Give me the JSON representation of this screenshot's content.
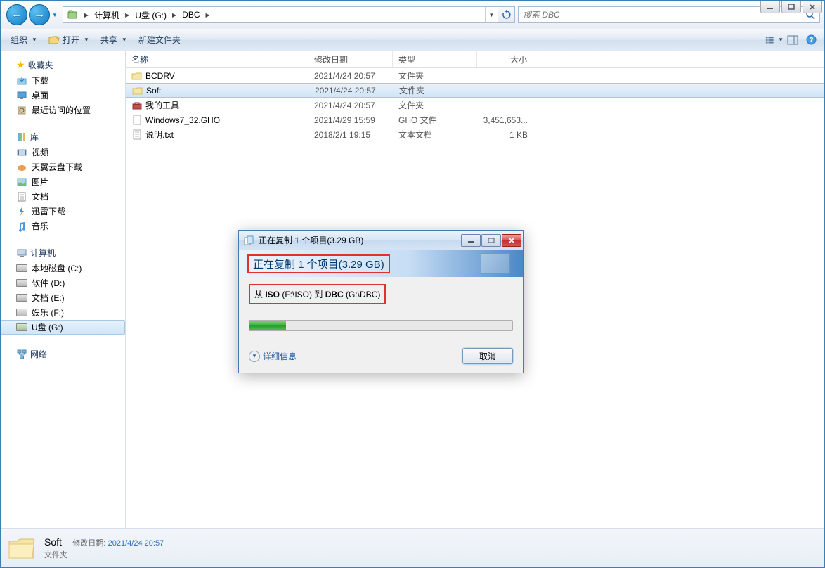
{
  "window_controls": {
    "minimize": "min",
    "maximize": "max",
    "close": "close"
  },
  "breadcrumbs": [
    {
      "label": "计算机"
    },
    {
      "label": "U盘 (G:)"
    },
    {
      "label": "DBC"
    }
  ],
  "search": {
    "placeholder": "搜索 DBC"
  },
  "toolbar": {
    "organize": "组织",
    "open": "打开",
    "share": "共享",
    "newfolder": "新建文件夹"
  },
  "tree": {
    "favorites": {
      "label": "收藏夹",
      "items": [
        "下载",
        "桌面",
        "最近访问的位置"
      ]
    },
    "libraries": {
      "label": "库",
      "items": [
        "视频",
        "天翼云盘下载",
        "图片",
        "文档",
        "迅雷下载",
        "音乐"
      ]
    },
    "computer": {
      "label": "计算机",
      "items": [
        "本地磁盘 (C:)",
        "软件 (D:)",
        "文档 (E:)",
        "娱乐 (F:)",
        "U盘 (G:)"
      ]
    },
    "network": {
      "label": "网络"
    }
  },
  "columns": {
    "name": "名称",
    "date": "修改日期",
    "type": "类型",
    "size": "大小"
  },
  "files": [
    {
      "name": "BCDRV",
      "date": "2021/4/24 20:57",
      "type": "文件夹",
      "size": "",
      "icon": "folder"
    },
    {
      "name": "Soft",
      "date": "2021/4/24 20:57",
      "type": "文件夹",
      "size": "",
      "icon": "folder",
      "selected": true
    },
    {
      "name": "我的工具",
      "date": "2021/4/24 20:57",
      "type": "文件夹",
      "size": "",
      "icon": "toolbox"
    },
    {
      "name": "Windows7_32.GHO",
      "date": "2021/4/29 15:59",
      "type": "GHO 文件",
      "size": "3,451,653...",
      "icon": "file"
    },
    {
      "name": "说明.txt",
      "date": "2018/2/1 19:15",
      "type": "文本文档",
      "size": "1 KB",
      "icon": "txt"
    }
  ],
  "status": {
    "name": "Soft",
    "date_label": "修改日期:",
    "date": "2021/4/24 20:57",
    "type": "文件夹"
  },
  "dialog": {
    "title": "正在复制 1 个项目(3.29 GB)",
    "header": "正在复制 1 个项目(3.29 GB)",
    "from_prefix": "从 ",
    "from_bold": "ISO",
    "from_path": " (F:\\ISO) 到 ",
    "to_bold": "DBC",
    "to_path": " (G:\\DBC)",
    "progress_percent": 14,
    "details": "详细信息",
    "cancel": "取消"
  }
}
